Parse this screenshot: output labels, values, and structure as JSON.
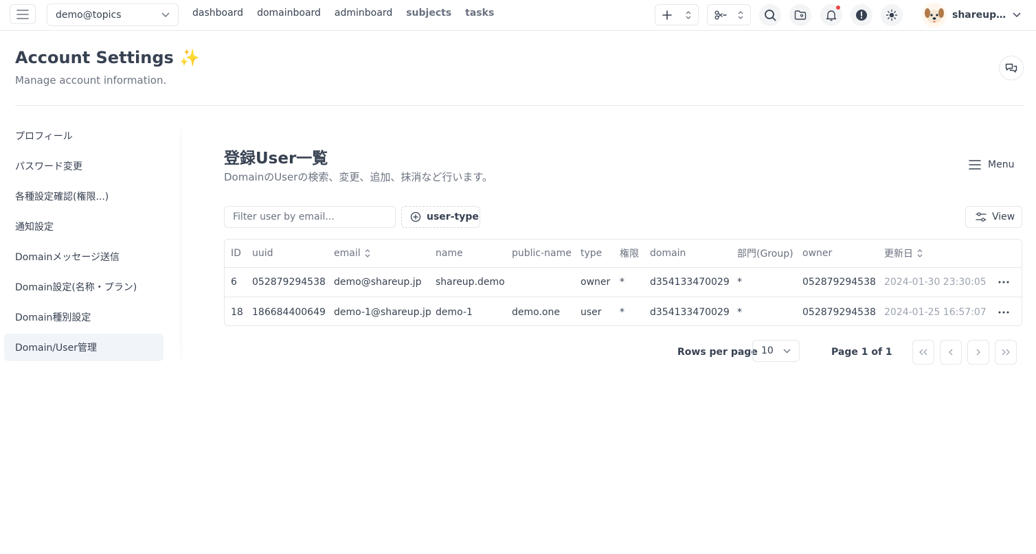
{
  "topbar": {
    "domain_select": "demo@topics",
    "nav": [
      "dashboard",
      "domainboard",
      "adminboard",
      "subjects",
      "tasks"
    ],
    "user_name": "shareup.demo"
  },
  "header": {
    "title": "Account Settings ✨",
    "subtitle": "Manage account information."
  },
  "sidebar": {
    "items": [
      {
        "label": "プロフィール"
      },
      {
        "label": "パスワード変更"
      },
      {
        "label": "各種設定確認(権限...)"
      },
      {
        "label": "通知設定"
      },
      {
        "label": "Domainメッセージ送信"
      },
      {
        "label": "Domain設定(名称・プラン)"
      },
      {
        "label": "Domain種別設定"
      },
      {
        "label": "Domain/User管理"
      }
    ]
  },
  "main": {
    "title": "登録User一覧",
    "description": "DomainのUserの検索、変更、追加、抹消など行います。",
    "menu_label": "Menu",
    "filter_placeholder": "Filter user by email...",
    "user_type_label": "user-type",
    "view_label": "View"
  },
  "table": {
    "columns": [
      "ID",
      "uuid",
      "email",
      "name",
      "public-name",
      "type",
      "権限",
      "domain",
      "部門(Group)",
      "owner",
      "更新日"
    ],
    "rows": [
      {
        "id": "6",
        "uuid": "052879294538",
        "email": "demo@shareup.jp",
        "name": "shareup.demo",
        "public_name": "",
        "type": "owner",
        "perm": "*",
        "domain": "d354133470029",
        "group": "*",
        "owner": "052879294538",
        "updated": "2024-01-30 23:30:05"
      },
      {
        "id": "18",
        "uuid": "186684400649",
        "email": "demo-1@shareup.jp",
        "name": "demo-1",
        "public_name": "demo.one",
        "type": "user",
        "perm": "*",
        "domain": "d354133470029",
        "group": "*",
        "owner": "052879294538",
        "updated": "2024-01-25 16:57:07"
      }
    ]
  },
  "pagination": {
    "rows_label": "Rows per page",
    "rows_value": "10",
    "page_label": "Page 1 of 1"
  },
  "colors": {
    "text": "#374151",
    "muted": "#6b7280",
    "border": "#e5e7eb",
    "active_bg": "#f1f4f9",
    "notification": "#ef4444"
  }
}
